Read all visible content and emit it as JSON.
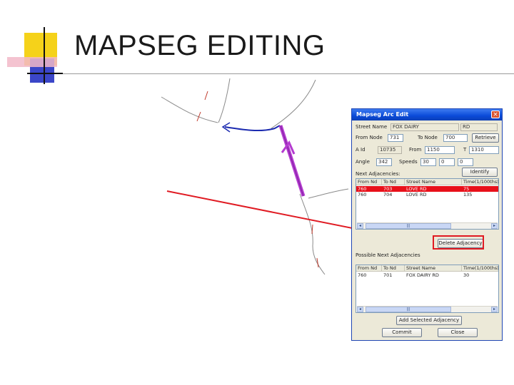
{
  "slide": {
    "title": "MAPSEG EDITING"
  },
  "colors": {
    "accent_red": "#e01a22",
    "edit_line": "#b43bd0",
    "arc_blue": "#1c2bb0",
    "logo_yellow": "#f5d21a",
    "logo_blue": "#3b46c8"
  },
  "dialog": {
    "title": "Mapseg Arc Edit",
    "close_glyph": "×",
    "street_name": {
      "label": "Street Name",
      "value": "FOX DAIRY",
      "suffix": "RD"
    },
    "from_node": {
      "label": "From Node",
      "value": "731"
    },
    "to_node": {
      "label": "To Node",
      "value": "700"
    },
    "retrieve_label": "Retrieve",
    "arc_id": {
      "label": "A Id",
      "value": "10735"
    },
    "from": {
      "label": "From",
      "value": "1150"
    },
    "to_addr": {
      "label": "T",
      "value": "1310"
    },
    "angle": {
      "label": "Angle",
      "value": "342"
    },
    "speeds": {
      "label": "Speeds",
      "values": [
        "30",
        "0",
        "0"
      ]
    },
    "identify_label": "Identify",
    "next_adjacencies_label": "Next Adjacencies:",
    "next_columns": [
      "From Nd",
      "To Nd",
      "Street Name",
      "Time(1/100ths)"
    ],
    "next_rows": [
      [
        "760",
        "703",
        "LOVE RD",
        "75"
      ],
      [
        "760",
        "704",
        "LOVE RD",
        "135"
      ]
    ],
    "delete_adjacency_label": "Delete Adjacency",
    "possible_adjacencies_label": "Possible Next Adjacencies",
    "possible_columns": [
      "From Nd",
      "To Nd",
      "Street Name",
      "Time(1/100ths)"
    ],
    "possible_rows": [
      [
        "760",
        "701",
        "FOX DAIRY RD",
        "30"
      ]
    ],
    "add_selected_label": "Add Selected Adjacency",
    "commit_label": "Commit",
    "close_label": "Close",
    "scroll_left": "◂",
    "scroll_right": "▸",
    "scroll_thumb": "|||"
  }
}
